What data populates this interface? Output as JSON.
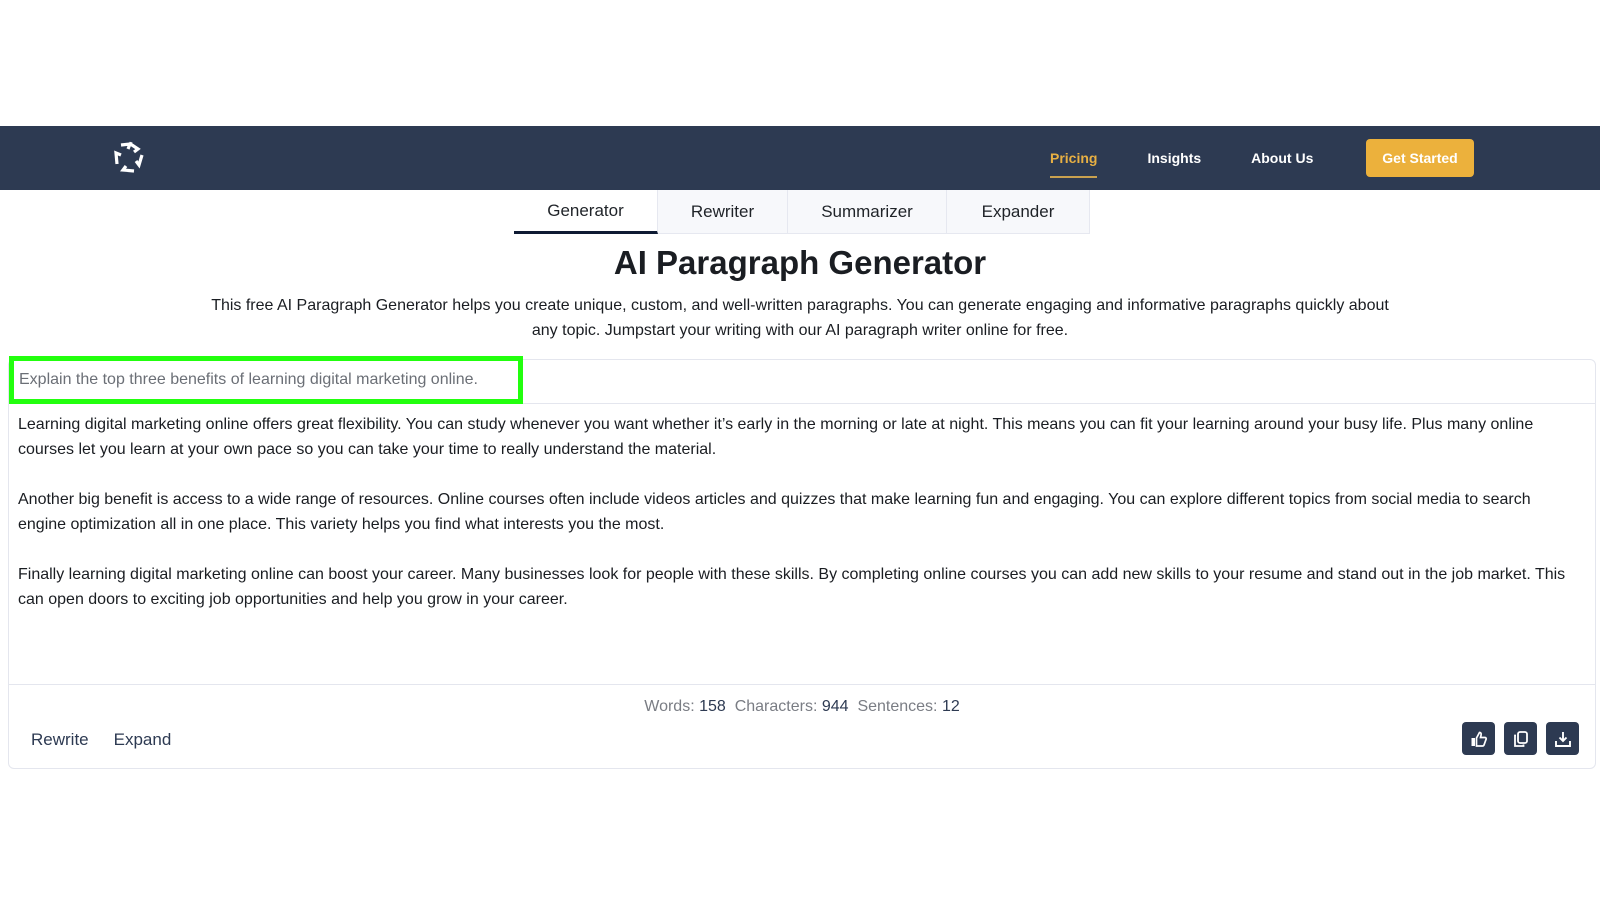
{
  "header": {
    "logo": "brand-logo",
    "nav": [
      {
        "label": "Pricing",
        "active": true
      },
      {
        "label": "Insights",
        "active": false
      },
      {
        "label": "About Us",
        "active": false
      }
    ],
    "cta_label": "Get Started",
    "colors": {
      "navbar": "#2d3a52",
      "accent": "#ecb13c"
    }
  },
  "tabs": [
    {
      "label": "Generator",
      "active": true
    },
    {
      "label": "Rewriter",
      "active": false
    },
    {
      "label": "Summarizer",
      "active": false
    },
    {
      "label": "Expander",
      "active": false
    }
  ],
  "page": {
    "title": "AI Paragraph Generator",
    "description": "This free AI Paragraph Generator helps you create unique, custom, and well-written paragraphs. You can generate engaging and informative paragraphs quickly about any topic. Jumpstart your writing with our AI paragraph writer online for free."
  },
  "editor": {
    "prompt_value": "Explain the top three benefits of learning digital marketing online.",
    "highlight_color": "#22ff0e",
    "output_paragraphs": [
      "Learning digital marketing online offers great flexibility. You can study whenever you want whether it’s early in the morning or late at night. This means you can fit your learning around your busy life. Plus many online courses let you learn at your own pace so you can take your time to really understand the material.",
      "Another big benefit is access to a wide range of resources. Online courses often include videos articles and quizzes that make learning fun and engaging. You can explore different topics from social media to search engine optimization all in one place. This variety helps you find what interests you the most.",
      "Finally learning digital marketing online can boost your career. Many businesses look for people with these skills. By completing online courses you can add new skills to your resume and stand out in the job market. This can open doors to exciting job opportunities and help you grow in your career."
    ],
    "stats": {
      "words_label": "Words:",
      "words": "158",
      "chars_label": "Characters:",
      "chars": "944",
      "sentences_label": "Sentences:",
      "sentences": "12"
    },
    "actions": [
      "Rewrite",
      "Expand"
    ],
    "icon_buttons": [
      "thumbs-up-icon",
      "copy-icon",
      "download-icon"
    ]
  }
}
